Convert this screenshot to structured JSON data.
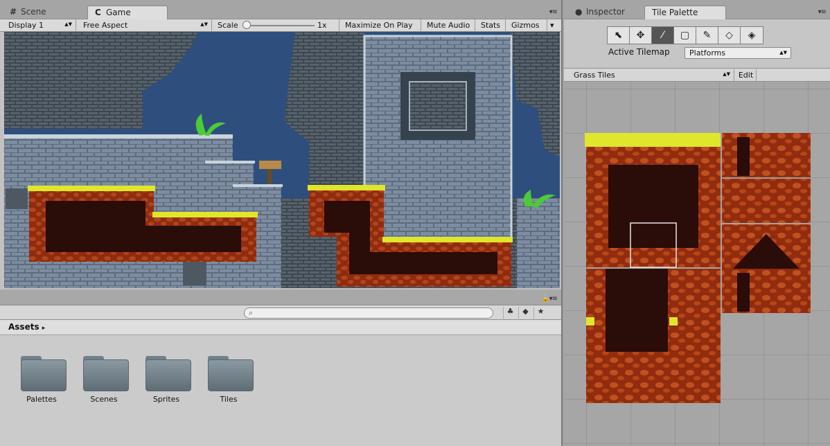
{
  "left_panel": {
    "tabs": [
      {
        "label": "Scene",
        "active": false
      },
      {
        "label": "Game",
        "active": true
      }
    ],
    "game_toolbar": {
      "display": "Display 1",
      "aspect": "Free Aspect",
      "scale_label": "Scale",
      "scale_value": "1x",
      "maximize": "Maximize On Play",
      "mute": "Mute Audio",
      "stats": "Stats",
      "gizmos": "Gizmos"
    },
    "project": {
      "search_placeholder": "",
      "breadcrumb": "Assets",
      "folders": [
        "Palettes",
        "Scenes",
        "Sprites",
        "Tiles"
      ]
    }
  },
  "right_panel": {
    "tabs": [
      {
        "label": "Inspector",
        "active": false
      },
      {
        "label": "Tile Palette",
        "active": true
      }
    ],
    "tools": [
      "select-icon",
      "move-icon",
      "paint-brush-icon",
      "box-fill-icon",
      "picker-icon",
      "eraser-icon",
      "flood-fill-icon"
    ],
    "selected_tool": "paint-brush-icon",
    "active_tilemap_label": "Active Tilemap",
    "active_tilemap_value": "Platforms",
    "palette_name": "Grass Tiles",
    "edit_label": "Edit"
  },
  "colors": {
    "sky": "#2e4f7d",
    "stone": "#6e7f92",
    "grass": "#e0e62a",
    "dirt": "#9a3312",
    "dirt_dark": "#2a0c08",
    "folder": "#76858d"
  }
}
